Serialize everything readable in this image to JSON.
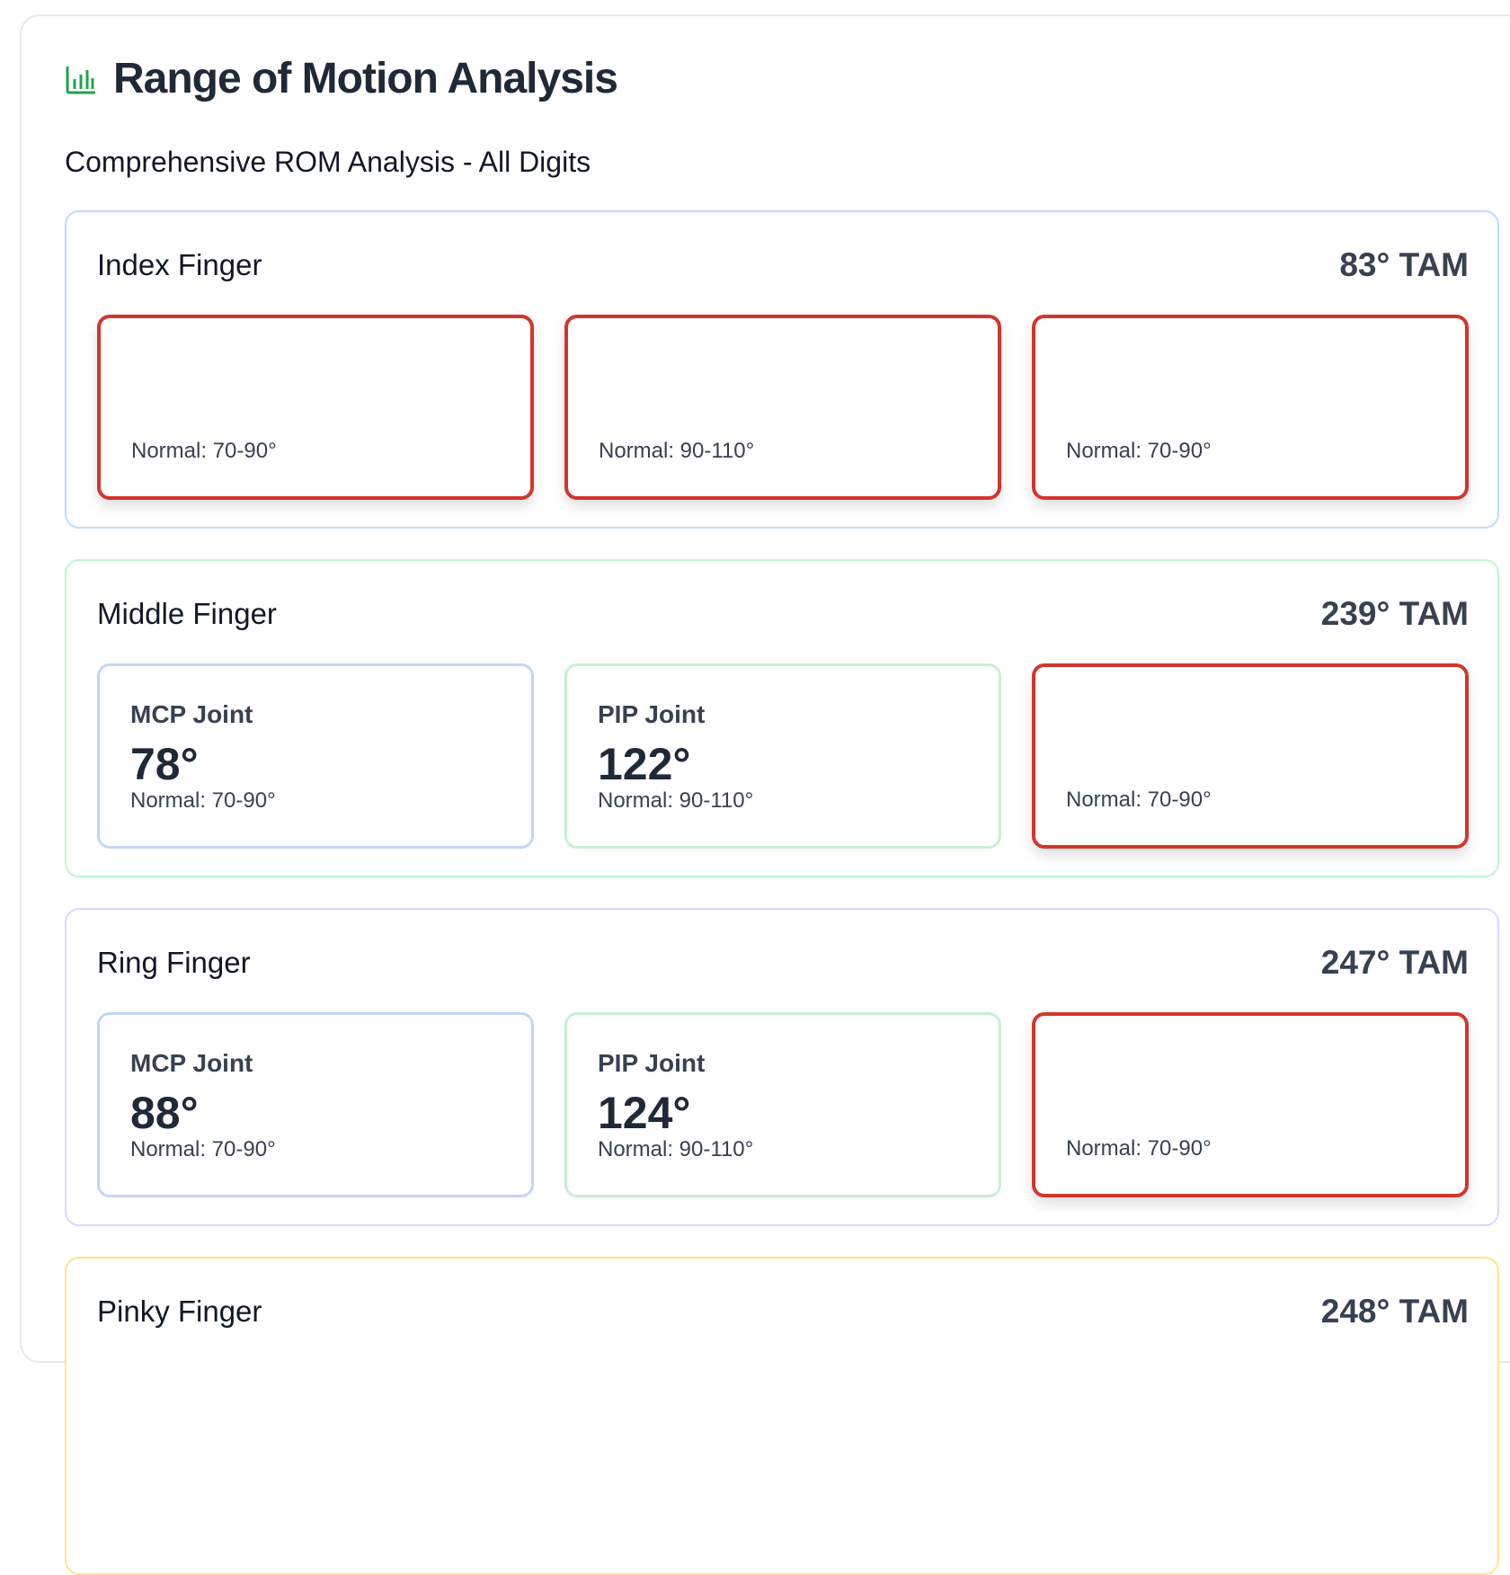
{
  "header": {
    "title": "Range of Motion Analysis",
    "icon": "bar-chart-icon",
    "icon_color": "#22a34a"
  },
  "subtitle": "Comprehensive ROM Analysis - All Digits",
  "fingers": [
    {
      "name": "Index Finger",
      "tam": "83° TAM",
      "joints": [
        {
          "label": "",
          "value": "",
          "normal": "Normal: 70-90°",
          "status": "red"
        },
        {
          "label": "",
          "value": "",
          "normal": "Normal: 90-110°",
          "status": "red"
        },
        {
          "label": "",
          "value": "",
          "normal": "Normal: 70-90°",
          "status": "red"
        }
      ]
    },
    {
      "name": "Middle Finger",
      "tam": "239° TAM",
      "joints": [
        {
          "label": "MCP Joint",
          "value": "78°",
          "normal": "Normal: 70-90°",
          "status": "blue"
        },
        {
          "label": "PIP Joint",
          "value": "122°",
          "normal": "Normal: 90-110°",
          "status": "green"
        },
        {
          "label": "",
          "value": "",
          "normal": "Normal: 70-90°",
          "status": "red"
        }
      ]
    },
    {
      "name": "Ring Finger",
      "tam": "247° TAM",
      "joints": [
        {
          "label": "MCP Joint",
          "value": "88°",
          "normal": "Normal: 70-90°",
          "status": "blue"
        },
        {
          "label": "PIP Joint",
          "value": "124°",
          "normal": "Normal: 90-110°",
          "status": "green"
        },
        {
          "label": "",
          "value": "",
          "normal": "Normal: 70-90°",
          "status": "red"
        }
      ]
    },
    {
      "name": "Pinky Finger",
      "tam": "248° TAM",
      "joints": []
    }
  ],
  "colors": {
    "red_border": "#d2352d",
    "blue_border": "#c3d6f5",
    "green_border": "#c6f0d3"
  }
}
